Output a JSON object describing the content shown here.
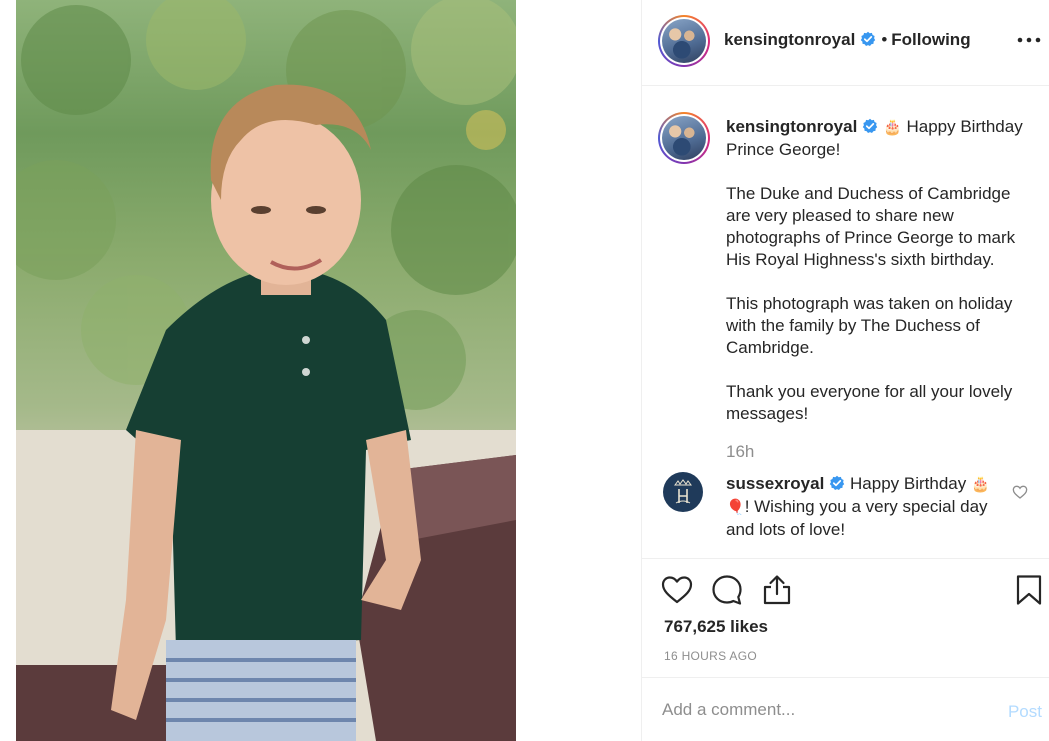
{
  "post": {
    "author": "kensingtonroyal",
    "follow_status": "Following",
    "separator": "•",
    "caption": {
      "line1_suffix": "Happy Birthday Prince George!",
      "paragraph2": "The Duke and Duchess of Cambridge are very pleased to share new photographs of Prince George to mark His Royal Highness's sixth birthday.",
      "paragraph3": "This photograph was taken on holiday with the family by The Duchess of Cambridge.",
      "paragraph4": "Thank you everyone for all your lovely messages!",
      "cake_emoji": "🎂"
    },
    "caption_timestamp": "16h",
    "comments": [
      {
        "author": "sussexroyal",
        "text_part1": "Happy Birthday",
        "text_part2": "! Wishing you a very special day and lots of love!",
        "cake_emoji": "🎂",
        "balloon_emoji": "🎈"
      }
    ],
    "likes": "767,625 likes",
    "time_ago": "16 HOURS AGO",
    "add_comment_placeholder": "Add a comment...",
    "post_button": "Post"
  },
  "icons": {
    "verified": "verified-badge-icon",
    "more": "more-options-icon",
    "like": "heart-icon",
    "comment": "comment-icon",
    "share": "share-icon",
    "save": "bookmark-icon",
    "comment_like": "small-heart-icon"
  },
  "colors": {
    "verified_blue": "#3897f0",
    "secondary_text": "#8e8e8e",
    "post_disabled": "#b3dbff",
    "border": "#efefef"
  }
}
